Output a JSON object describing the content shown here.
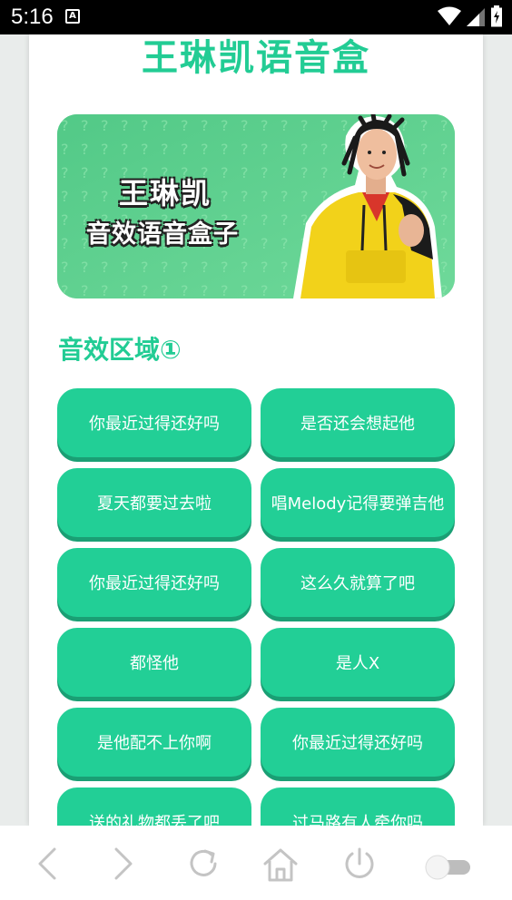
{
  "status_bar": {
    "time": "5:16",
    "notification_icon": "A"
  },
  "app": {
    "title": "王琳凯语音盒"
  },
  "banner": {
    "line1": "王琳凯",
    "line2": "音效语音盒子"
  },
  "section": {
    "title": "音效区域①"
  },
  "sounds": [
    "你最近过得还好吗",
    "是否还会想起他",
    "夏天都要过去啦",
    "唱Melody记得要弹吉他",
    "你最近过得还好吗",
    "这么久就算了吧",
    "都怪他",
    "是人X",
    "是他配不上你啊",
    "你最近过得还好吗",
    "送的礼物都丢了吧",
    "过马路有人牵你吗"
  ],
  "nav": {
    "items": [
      "back-icon",
      "forward-icon",
      "refresh-icon",
      "home-icon",
      "power-icon",
      "toggle-switch"
    ]
  },
  "colors": {
    "accent": "#22cc94",
    "button": "#22cf96",
    "banner_bg": "#5fd28c"
  }
}
